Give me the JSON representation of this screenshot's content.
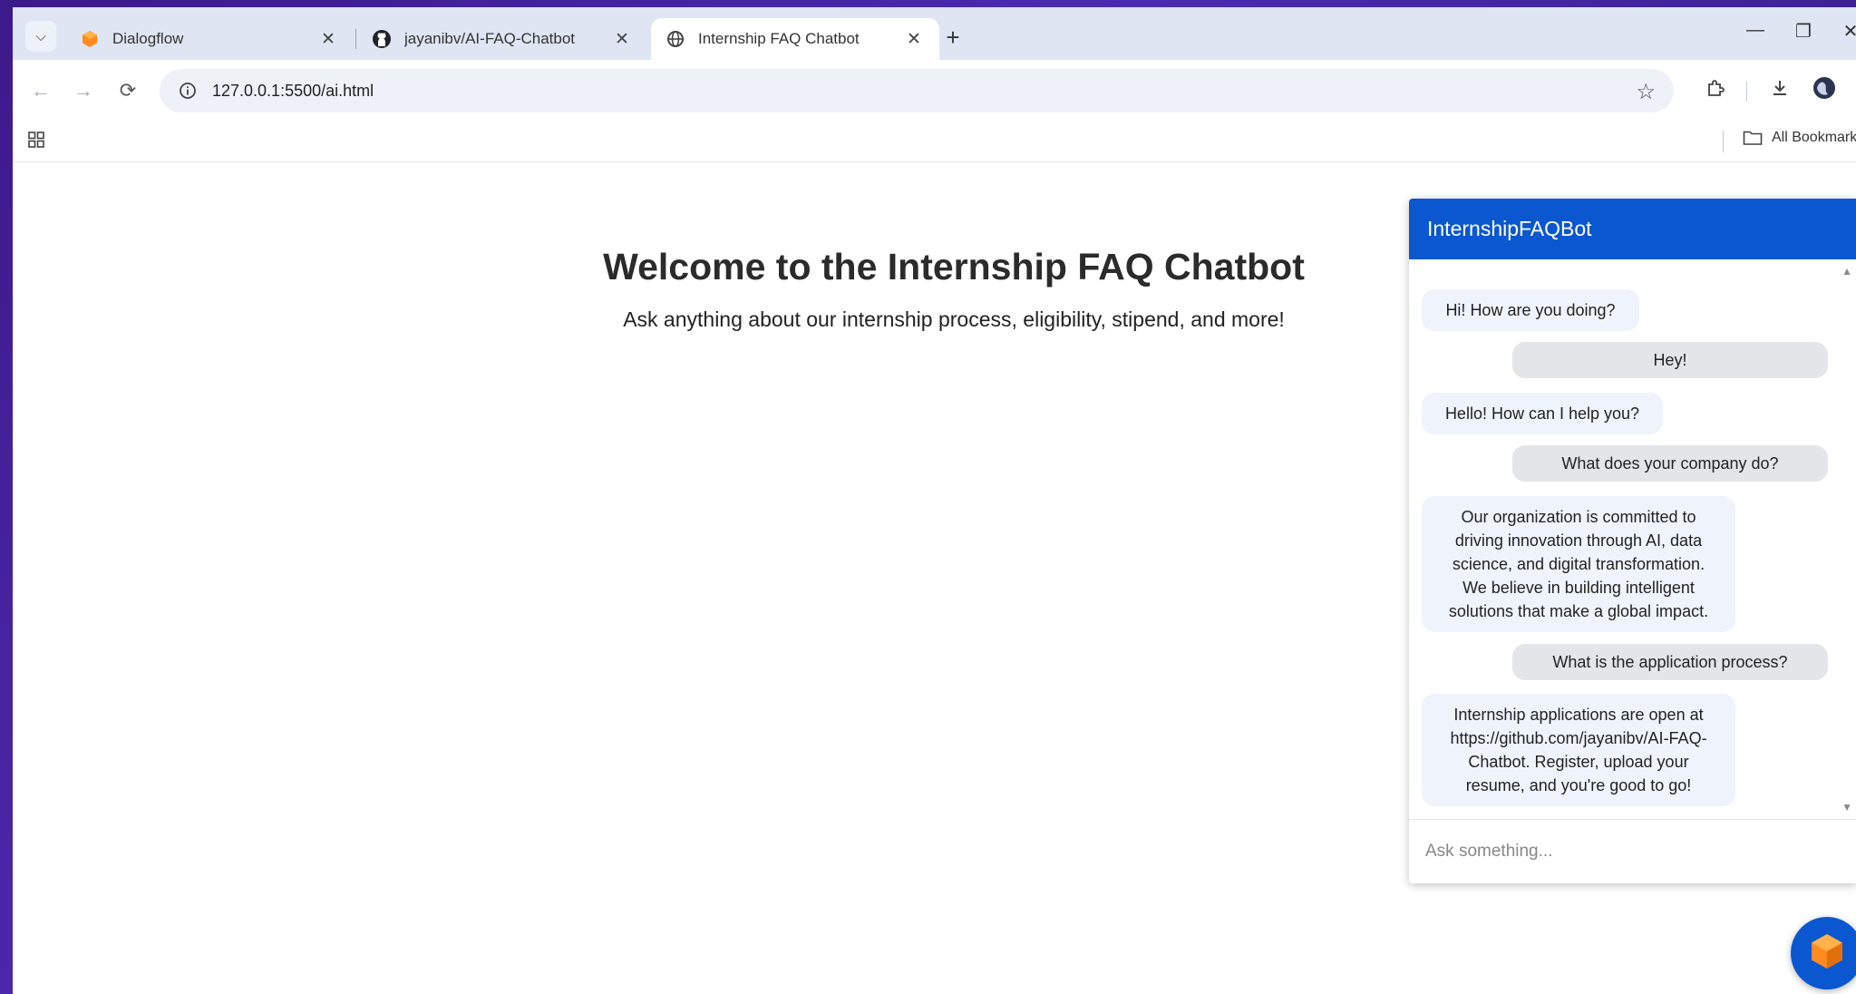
{
  "tabs": [
    {
      "label": "Dialogflow",
      "icon": "dialogflow-icon"
    },
    {
      "label": "jayanibv/AI-FAQ-Chatbot",
      "icon": "github-icon"
    },
    {
      "label": "Internship FAQ Chatbot",
      "icon": "globe-icon",
      "active": true
    }
  ],
  "toolbar": {
    "url": "127.0.0.1:5500/ai.html"
  },
  "bookmarks": {
    "all_label": "All Bookmarks"
  },
  "page": {
    "title": "Welcome to the Internship FAQ Chatbot",
    "subtitle": "Ask anything about our internship process, eligibility, stipend, and more!"
  },
  "chat": {
    "header": "InternshipFAQBot",
    "messages": [
      {
        "sender": "bot",
        "text": "Hi! How are you doing?"
      },
      {
        "sender": "user",
        "text": "Hey!"
      },
      {
        "sender": "bot",
        "text": "Hello! How can I help you?"
      },
      {
        "sender": "user",
        "text": "What does your company do?"
      },
      {
        "sender": "bot",
        "text": "Our organization is committed to driving innovation through AI, data science, and digital transformation. We believe in building intelligent solutions that make a global impact."
      },
      {
        "sender": "user",
        "text": "What is the application process?"
      },
      {
        "sender": "bot",
        "text": "Internship applications are open at https://github.com/jayanibv/AI-FAQ-Chatbot. Register, upload your resume, and you're good to go!"
      }
    ],
    "input_placeholder": "Ask something..."
  },
  "colors": {
    "header_blue": "#0b57d0",
    "bot_bubble": "#eef3fc",
    "user_bubble": "#e3e5e8",
    "dialogflow_orange": "#ff8a1f"
  }
}
